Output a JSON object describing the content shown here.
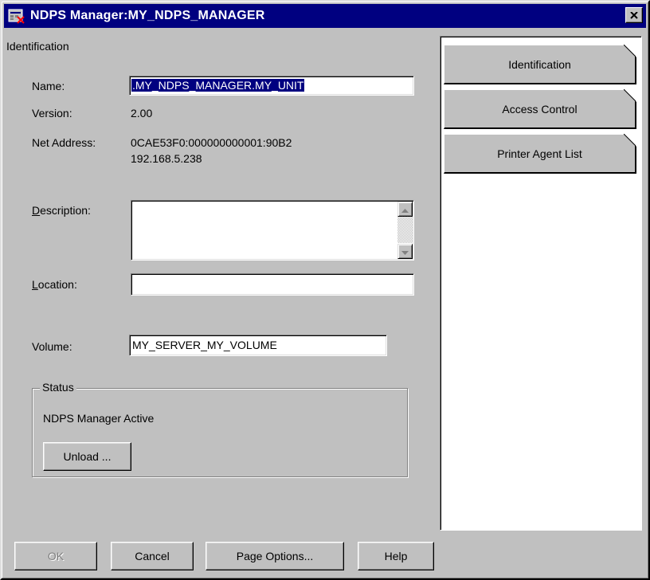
{
  "window": {
    "title": "NDPS Manager:MY_NDPS_MANAGER",
    "close_glyph": "×"
  },
  "page": {
    "section_title": "Identification",
    "name_label": "Name:",
    "name_value": ".MY_NDPS_MANAGER.MY_UNIT",
    "version_label": "Version:",
    "version_value": "2.00",
    "net_address_label": "Net Address:",
    "net_address_line1": "0CAE53F0:000000000001:90B2",
    "net_address_line2": "192.168.5.238",
    "description_label": "Description:",
    "description_value": "",
    "location_label": "Location:",
    "location_value": "",
    "volume_label": "Volume:",
    "volume_value": "MY_SERVER_MY_VOLUME",
    "status_group_title": "Status",
    "status_text": "NDPS Manager Active",
    "unload_button": "Unload ..."
  },
  "page_tabs": [
    {
      "label": "Identification",
      "active": true
    },
    {
      "label": "Access Control",
      "active": false
    },
    {
      "label": "Printer Agent List",
      "active": false
    }
  ],
  "buttons": {
    "ok": "OK",
    "cancel": "Cancel",
    "page_options": "Page Options...",
    "help": "Help"
  },
  "colors": {
    "titlebar": "#000080",
    "face": "#c0c0c0",
    "selection": "#000080"
  },
  "icons": {
    "title": "ndps-manager-icon",
    "close": "close-icon",
    "scroll_up": "scroll-up-arrow-icon",
    "scroll_down": "scroll-down-arrow-icon"
  }
}
